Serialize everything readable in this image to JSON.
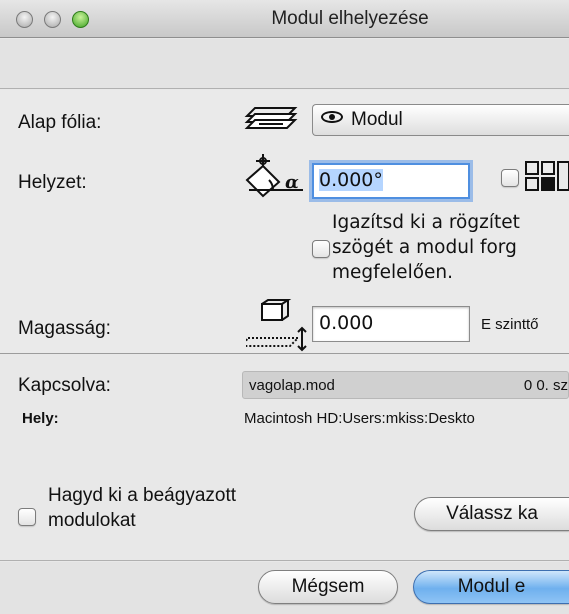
{
  "window": {
    "title": "Modul elhelyezése"
  },
  "form": {
    "layer": {
      "label": "Alap fólia:",
      "value": "Modul",
      "value_icon": "eye-icon"
    },
    "position": {
      "label": "Helyzet:",
      "angle_value": "0.000°"
    },
    "align_option": {
      "line1": "Igazítsd ki a rögzítet",
      "line2": "szögét a modul forg",
      "line3": "megfelelően."
    },
    "elevation": {
      "label": "Magasság:",
      "value": "0.000",
      "reference": "E szinttő"
    }
  },
  "linked": {
    "label": "Kapcsolva:",
    "file": "vagolap.mod",
    "story": "0  0. sz",
    "location_label": "Hely:",
    "location_value": "Macintosh HD:Users:mkiss:Deskto"
  },
  "options": {
    "skip_nested_line1": "Hagyd ki a beágyazott",
    "skip_nested_line2": "modulokat",
    "choose_button": "Válassz ka"
  },
  "footer": {
    "cancel": "Mégsem",
    "place": "Modul e"
  }
}
